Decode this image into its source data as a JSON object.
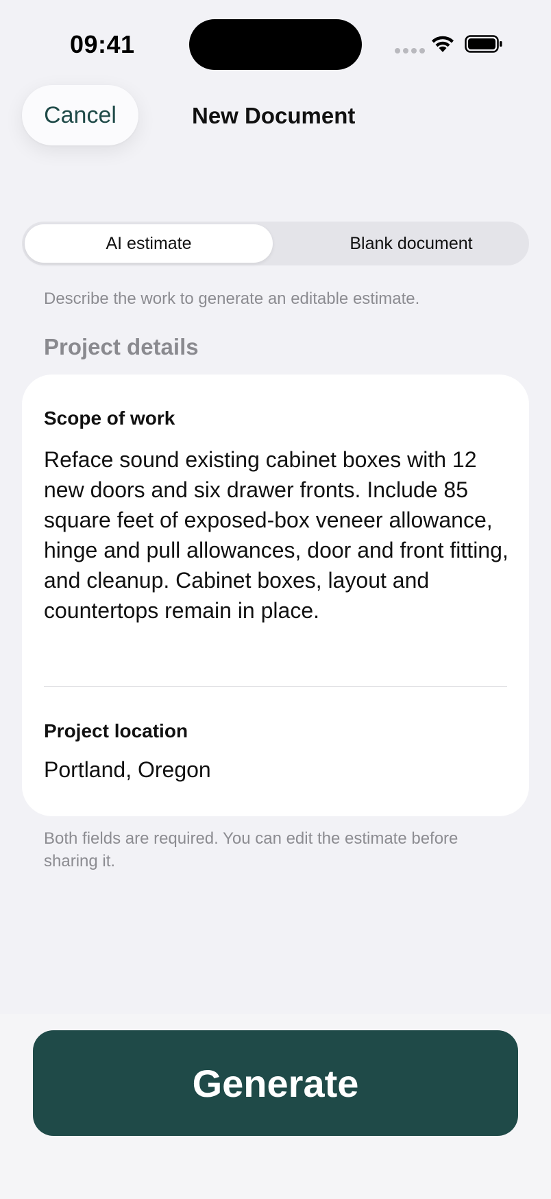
{
  "status_bar": {
    "time": "09:41"
  },
  "nav": {
    "cancel_label": "Cancel",
    "title": "New Document"
  },
  "mode_picker": {
    "options": [
      "AI estimate",
      "Blank document"
    ],
    "selected": "AI estimate"
  },
  "hint": "Describe the work to generate an editable estimate.",
  "section_header": "Project details",
  "form": {
    "scope_label": "Scope of work",
    "scope_value": "Reface sound existing cabinet boxes with 12 new doors and six drawer fronts. Include 85 square feet of exposed-box veneer allowance, hinge and pull allowances, door and front fitting, and cleanup. Cabinet boxes, layout and countertops remain in place.",
    "location_label": "Project location",
    "location_value": "Portland, Oregon"
  },
  "footnote": "Both fields are required. You can edit the estimate before sharing it.",
  "actions": {
    "generate_label": "Generate"
  },
  "colors": {
    "accent": "#1f4a48",
    "background": "#f2f2f6",
    "secondary_text": "#8c8c91"
  },
  "icons": [
    "cellular-signal-icon",
    "wifi-icon",
    "battery-icon"
  ]
}
